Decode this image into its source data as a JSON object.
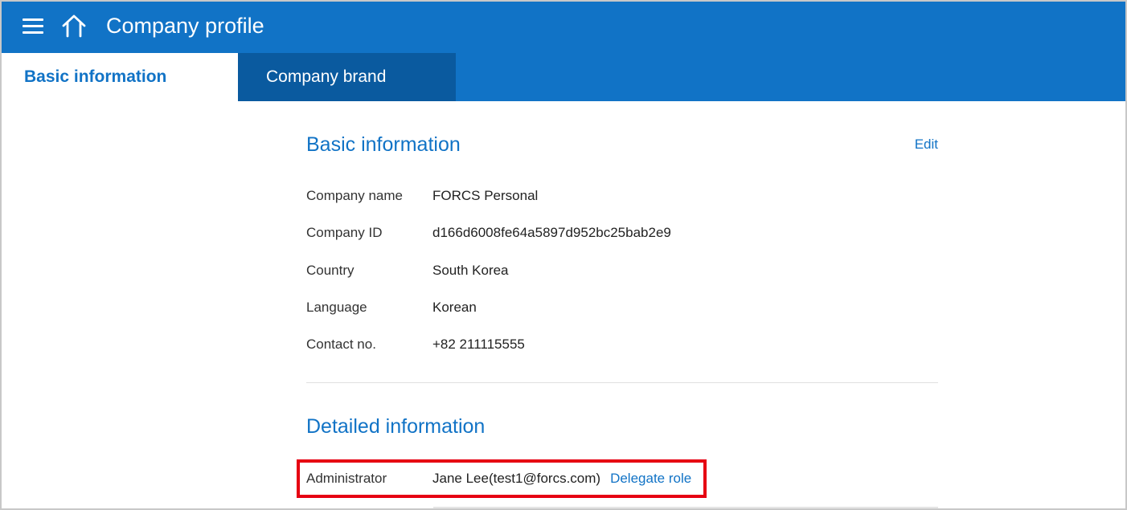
{
  "header": {
    "title": "Company profile",
    "menu_icon": "hamburger-menu-icon",
    "home_icon": "home-icon",
    "background": "#1173c6"
  },
  "tabs": [
    {
      "label": "Basic information",
      "active": true
    },
    {
      "label": "Company brand",
      "active": false
    }
  ],
  "basic_section": {
    "title": "Basic information",
    "edit_label": "Edit",
    "fields": [
      {
        "label": "Company name",
        "value": "FORCS Personal"
      },
      {
        "label": "Company ID",
        "value": "d166d6008fe64a5897d952bc25bab2e9"
      },
      {
        "label": "Country",
        "value": "South Korea"
      },
      {
        "label": "Language",
        "value": "Korean"
      },
      {
        "label": "Contact no.",
        "value": "+82 211115555"
      }
    ]
  },
  "detailed_section": {
    "title": "Detailed information",
    "administrator": {
      "label": "Administrator",
      "value": "Jane Lee(test1@forcs.com)",
      "action_label": "Delegate role"
    },
    "highlight_color": "#e60012"
  }
}
